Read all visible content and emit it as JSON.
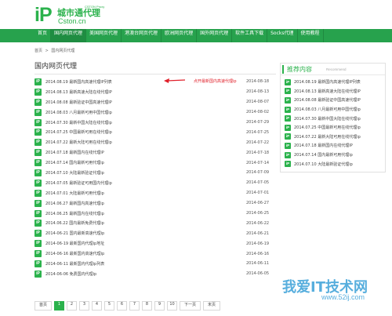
{
  "logo": {
    "mark": "iP",
    "name": "城市通代理",
    "tiny": "CSTON Proxy",
    "domain": "Cston.cn"
  },
  "nav": {
    "items": [
      {
        "label": "首页",
        "active": false
      },
      {
        "label": "国内网页代理",
        "active": true
      },
      {
        "label": "美国网页代理",
        "active": false
      },
      {
        "label": "港澳台网页代理",
        "active": false
      },
      {
        "label": "欧洲网页代理",
        "active": false
      },
      {
        "label": "国外网页代理",
        "active": false
      },
      {
        "label": "软件工具下载",
        "active": false
      },
      {
        "label": "Socks代理",
        "active": false
      },
      {
        "label": "使用教程",
        "active": false
      }
    ]
  },
  "breadcrumb": {
    "home": "首页",
    "sep": ">",
    "current": "国内网页代理"
  },
  "main": {
    "title": "国内网页代理",
    "annotation": "点开最新国内高速代理ip",
    "rows": [
      {
        "badge": "iP",
        "title": "2014.08.19 最新国内高速代理IP列表",
        "date": "2014-08-18"
      },
      {
        "badge": "iP",
        "title": "2014.08.13 最新高速大陆在线代理IP",
        "date": "2014-08-13"
      },
      {
        "badge": "iP",
        "title": "2014.08.08 最新验证中国高速代理IP",
        "date": "2014-08-07"
      },
      {
        "badge": "iP",
        "title": "2014.08.03 八月最新可用中国代理ip",
        "date": "2014-08-02"
      },
      {
        "badge": "iP",
        "title": "2014.07.30 最新中国大陆在线代理ip",
        "date": "2014-07-29"
      },
      {
        "badge": "iP",
        "title": "2014.07.25 中国最新可用在线代理ip",
        "date": "2014-07-25"
      },
      {
        "badge": "iP",
        "title": "2014.07.22 最新大陆可用在线代理ip",
        "date": "2014-07-22"
      },
      {
        "badge": "iP",
        "title": "2014.07.18 最新国内在线代理IP",
        "date": "2014-07-18"
      },
      {
        "badge": "iP",
        "title": "2014.07.14 国内最新可用代理ip",
        "date": "2014-07-14"
      },
      {
        "badge": "iP",
        "title": "2014.07.10 大陆最新验证代理ip",
        "date": "2014-07-09"
      },
      {
        "badge": "iP",
        "title": "2014.07.05 最新验证可用国内代理ip",
        "date": "2014-07-05"
      },
      {
        "badge": "iP",
        "title": "2014.07.01 大陆最新可用代理ip",
        "date": "2014-07-01"
      },
      {
        "badge": "iP",
        "title": "2014.06.27 最新国内高速代理ip",
        "date": "2014-06-27"
      },
      {
        "badge": "iP",
        "title": "2014.06.25 最新国内在线代理ip",
        "date": "2014-06-25"
      },
      {
        "badge": "iP",
        "title": "2014.06.22 国内最新免费代理ip",
        "date": "2014-06-22"
      },
      {
        "badge": "iP",
        "title": "2014-06-21 国内最新高速代理ip",
        "date": "2014-06-21"
      },
      {
        "badge": "iP",
        "title": "2014-06-19 最新国内代理ip地址",
        "date": "2014-06-19"
      },
      {
        "badge": "iP",
        "title": "2014-06-16 最新国内高速代理ip",
        "date": "2014-06-16"
      },
      {
        "badge": "iP",
        "title": "2014-06-11 最新国内代理ip列表",
        "date": "2014-06-11"
      },
      {
        "badge": "iP",
        "title": "2014-06-06 免费国内代理ip",
        "date": "2014-06-05"
      }
    ]
  },
  "pager": {
    "first": "首页",
    "pages": [
      "1",
      "2",
      "3",
      "4",
      "5",
      "6",
      "7",
      "8",
      "9",
      "10"
    ],
    "current": "1",
    "next": "下一页",
    "last": "末页"
  },
  "sidebar": {
    "title": "推荐内容",
    "subtitle": "Recommend",
    "items": [
      {
        "badge": "iP",
        "text": "2014.08.19 最新国内高速代理IP列表"
      },
      {
        "badge": "iP",
        "text": "2014.08.13 最新高速大陆在线代理IP"
      },
      {
        "badge": "iP",
        "text": "2014.08.08 最新验证中国高速代理IP"
      },
      {
        "badge": "iP",
        "text": "2014.08.03 八月最新可用中国代理ip"
      },
      {
        "badge": "iP",
        "text": "2014.07.30 最新中国大陆在线代理ip"
      },
      {
        "badge": "iP",
        "text": "2014.07.25 中国最新可用在线代理ip"
      },
      {
        "badge": "iP",
        "text": "2014.07.22 最新大陆可用在线代理ip"
      },
      {
        "badge": "iP",
        "text": "2014.07.18 最新国内在线代理IP"
      },
      {
        "badge": "iP",
        "text": "2014.07.14 国内最新可用代理ip"
      },
      {
        "badge": "iP",
        "text": "2014.07.10 大陆最新验证代理ip"
      }
    ]
  },
  "watermark": {
    "text": "我爱IT技术网",
    "url": "www.52ij.com"
  },
  "colors": {
    "brand": "#2bb24c",
    "nav": "#27a24d",
    "annotation": "#e0202a"
  }
}
